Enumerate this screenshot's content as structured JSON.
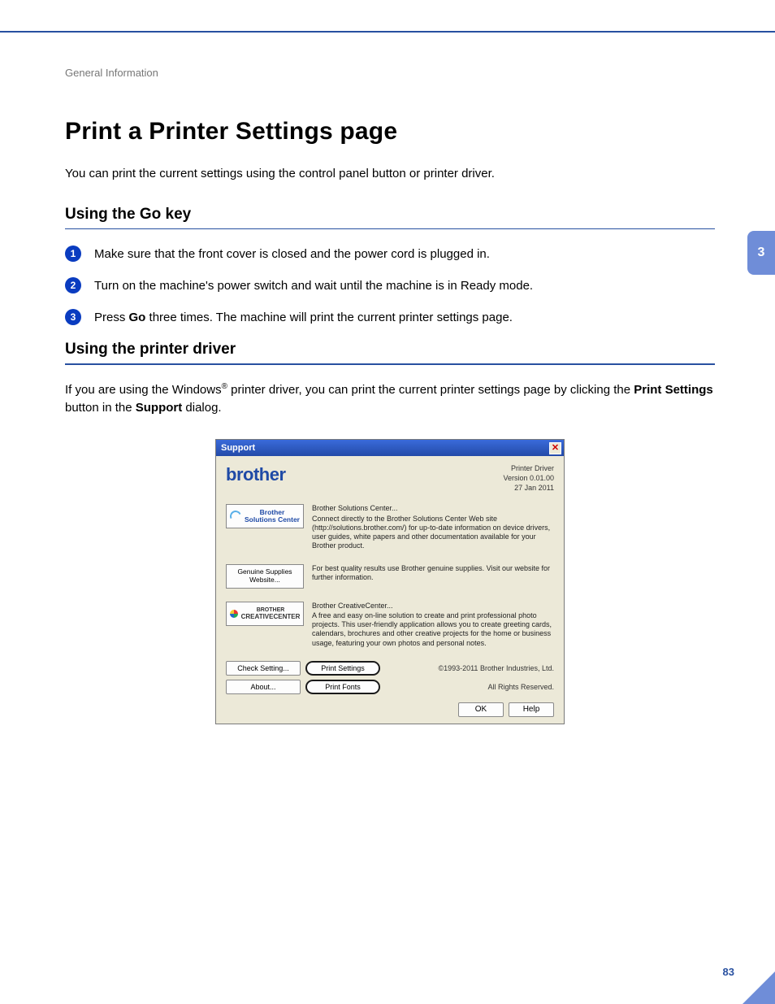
{
  "breadcrumb": "General Information",
  "chapter_tab": "3",
  "page_number": "83",
  "h1": "Print a Printer Settings page",
  "intro": "You can print the current settings using the control panel button or printer driver.",
  "section1": {
    "heading": "Using the Go key",
    "steps": [
      "Make sure that the front cover is closed and the power cord is plugged in.",
      "Turn on the machine's power switch and wait until the machine is in Ready mode."
    ],
    "step3_prefix": "Press ",
    "step3_bold": "Go",
    "step3_suffix": " three times. The machine will print the current printer settings page."
  },
  "section2": {
    "heading": "Using the printer driver",
    "para_prefix": "If you are using the Windows",
    "para_sup": "®",
    "para_mid": " printer driver, you can print the current printer settings page by clicking the ",
    "bold1": "Print Settings",
    "mid2": " button in the ",
    "bold2": "Support",
    "suffix": " dialog."
  },
  "dialog": {
    "title": "Support",
    "close": "✕",
    "brand": "brother",
    "ver_line1": "Printer Driver",
    "ver_line2": "Version 0.01.00",
    "ver_line3": "27 Jan 2011",
    "bsc_btn_line1": "Brother",
    "bsc_btn_line2": "Solutions Center",
    "bsc_title": "Brother Solutions Center...",
    "bsc_desc": "Connect directly to the Brother Solutions Center Web site (http://solutions.brother.com/) for up-to-date information on device drivers, user guides, white papers and other documentation available for your Brother product.",
    "supplies_btn": "Genuine Supplies Website...",
    "supplies_desc": "For best quality results use Brother genuine supplies. Visit our website for further information.",
    "cc_btn_line1": "BROTHER",
    "cc_btn_line2": "CREATIVECENTER",
    "cc_title": "Brother CreativeCenter...",
    "cc_desc": "A free and easy on-line solution to create and print professional photo projects. This user-friendly application allows you to create greeting cards, calendars, brochures and other creative projects for the home or business usage, featuring your own photos and personal notes.",
    "check_setting": "Check Setting...",
    "print_settings": "Print Settings",
    "about": "About...",
    "print_fonts": "Print Fonts",
    "copyright": "©1993-2011 Brother Industries, Ltd.",
    "rights": "All Rights Reserved.",
    "ok": "OK",
    "help": "Help"
  }
}
